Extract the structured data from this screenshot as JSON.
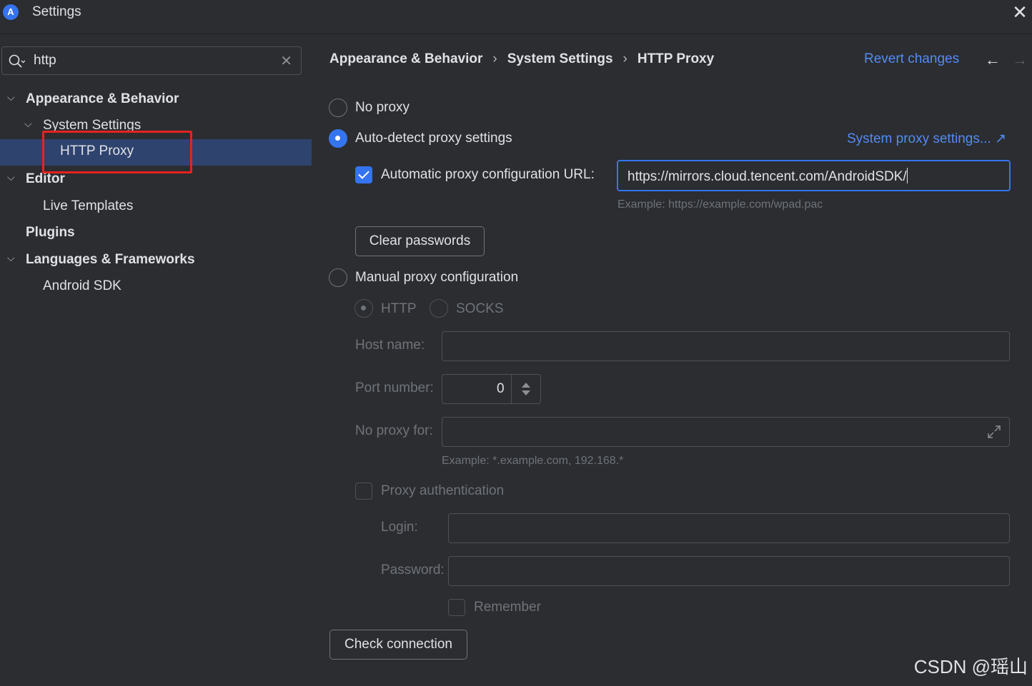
{
  "window": {
    "title": "Settings",
    "logo_letter": "A"
  },
  "search": {
    "value": "http"
  },
  "tree": [
    {
      "label": "Appearance & Behavior"
    },
    {
      "label": "System Settings"
    },
    {
      "label": "HTTP Proxy"
    },
    {
      "label": "Editor"
    },
    {
      "label": "Live Templates"
    },
    {
      "label": "Plugins"
    },
    {
      "label": "Languages & Frameworks"
    },
    {
      "label": "Android SDK"
    }
  ],
  "breadcrumb": [
    "Appearance & Behavior",
    "System Settings",
    "HTTP Proxy"
  ],
  "header": {
    "revert": "Revert changes"
  },
  "proxy": {
    "no_proxy": "No proxy",
    "auto_detect": "Auto-detect proxy settings",
    "system_proxy_link": "System proxy settings... ↗",
    "auto_url_label": "Automatic proxy configuration URL:",
    "auto_url_value": "https://mirrors.cloud.tencent.com/AndroidSDK/",
    "auto_url_example": "Example: https://example.com/wpad.pac",
    "clear_passwords": "Clear passwords",
    "manual": "Manual proxy configuration",
    "http": "HTTP",
    "socks": "SOCKS",
    "host_label": "Host name:",
    "port_label": "Port number:",
    "port_value": "0",
    "no_proxy_for_label": "No proxy for:",
    "no_proxy_example": "Example: *.example.com, 192.168.*",
    "proxy_auth": "Proxy authentication",
    "login_label": "Login:",
    "password_label": "Password:",
    "remember": "Remember",
    "check_connection": "Check connection"
  },
  "watermark": "CSDN @瑶山",
  "colors": {
    "accent": "#3574f0",
    "link": "#548af7",
    "highlight_box": "#e8221f",
    "selection": "#2e436e"
  }
}
